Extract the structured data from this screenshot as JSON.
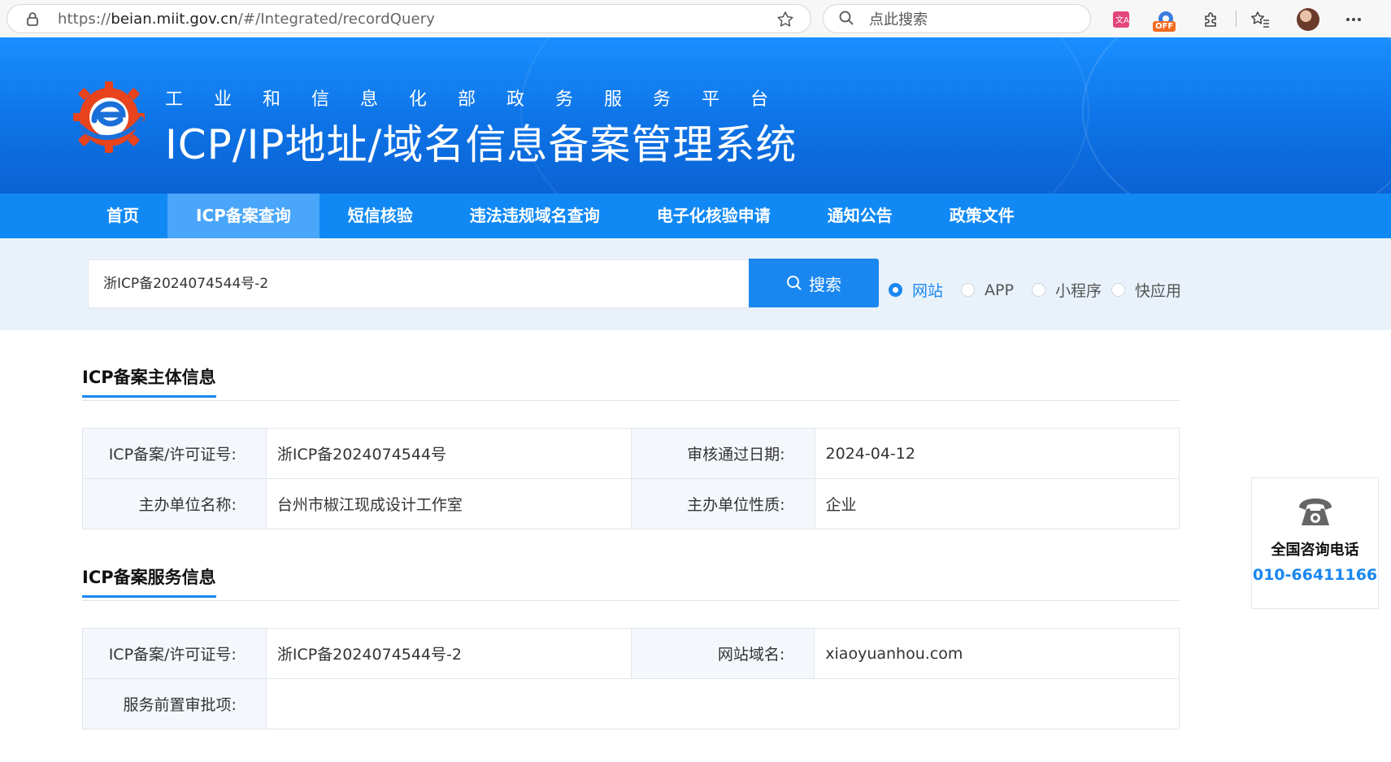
{
  "browser": {
    "url_prefix": "https://",
    "url_host": "beian.miit.gov.cn",
    "url_path": "/#/Integrated/recordQuery",
    "search_placeholder": "点此搜索",
    "extension_badge": "OFF"
  },
  "header": {
    "subtitle": "工业和信息化部政务服务平台",
    "title": "ICP/IP地址/域名信息备案管理系统"
  },
  "nav": {
    "items": [
      {
        "label": "首页"
      },
      {
        "label": "ICP备案查询"
      },
      {
        "label": "短信核验"
      },
      {
        "label": "违法违规域名查询"
      },
      {
        "label": "电子化核验申请"
      },
      {
        "label": "通知公告"
      },
      {
        "label": "政策文件"
      }
    ],
    "active": "ICP备案查询"
  },
  "search": {
    "value": "浙ICP备2024074544号-2",
    "button_label": "搜索",
    "options": [
      {
        "label": "网站",
        "checked": true
      },
      {
        "label": "APP",
        "checked": false
      },
      {
        "label": "小程序",
        "checked": false
      },
      {
        "label": "快应用",
        "checked": false
      }
    ]
  },
  "subject_info": {
    "title": "ICP备案主体信息",
    "rows": [
      {
        "k1": "ICP备案/许可证号:",
        "v1": "浙ICP备2024074544号",
        "k2": "审核通过日期:",
        "v2": "2024-04-12"
      },
      {
        "k1": "主办单位名称:",
        "v1": "台州市椒江现成设计工作室",
        "k2": "主办单位性质:",
        "v2": "企业"
      }
    ]
  },
  "service_info": {
    "title": "ICP备案服务信息",
    "rows": [
      {
        "k1": "ICP备案/许可证号:",
        "v1": "浙ICP备2024074544号-2",
        "k2": "网站域名:",
        "v2": "xiaoyuanhou.com"
      },
      {
        "k1": "服务前置审批项:",
        "v1": ""
      }
    ]
  },
  "consult": {
    "title": "全国咨询电话",
    "phone": "010-66411166"
  },
  "colors": {
    "brand_blue": "#1089f5",
    "accent": "#1a87f0"
  }
}
